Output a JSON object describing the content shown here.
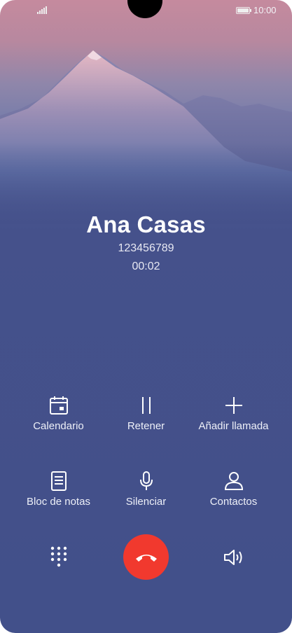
{
  "status_bar": {
    "time": "10:00"
  },
  "call": {
    "name": "Ana Casas",
    "number": "123456789",
    "duration": "00:02"
  },
  "actions": [
    {
      "label": "Calendario",
      "icon": "calendar-icon"
    },
    {
      "label": "Retener",
      "icon": "pause-icon"
    },
    {
      "label": "Añadir llamada",
      "icon": "plus-icon"
    },
    {
      "label": "Bloc de notas",
      "icon": "notes-icon"
    },
    {
      "label": "Silenciar",
      "icon": "microphone-icon"
    },
    {
      "label": "Contactos",
      "icon": "contact-icon"
    }
  ],
  "bottom": {
    "keypad_icon": "dialpad-icon",
    "end_call_icon": "hangup-icon",
    "speaker_icon": "speaker-icon"
  },
  "colors": {
    "end_call": "#f1392e",
    "background": "#42508a"
  }
}
